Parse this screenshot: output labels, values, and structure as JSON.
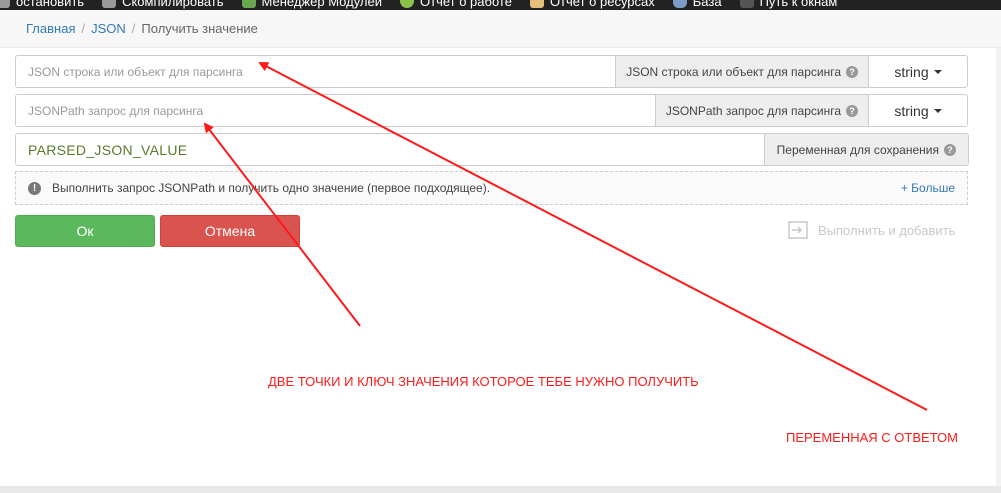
{
  "toolbar": {
    "items": [
      {
        "label": "остановить",
        "icon": "stop-icon"
      },
      {
        "label": "Скомпилировать",
        "icon": "compile-icon"
      },
      {
        "label": "Менеджер Модулей",
        "icon": "module-manager-icon"
      },
      {
        "label": "Отчет о работе",
        "icon": "chart-icon"
      },
      {
        "label": "Отчет о ресурсах",
        "icon": "folder-icon"
      },
      {
        "label": "База",
        "icon": "database-icon"
      },
      {
        "label": "Путь к окнам",
        "icon": "window-icon"
      }
    ]
  },
  "breadcrumb": {
    "home": "Главная",
    "section": "JSON",
    "current": "Получить значение",
    "separator": "/"
  },
  "form": {
    "json_string": {
      "value": "",
      "placeholder": "JSON строка или объект для парсинга",
      "label": "JSON строка или объект для парсинга",
      "type": "string"
    },
    "jsonpath": {
      "value": "",
      "placeholder": "JSONPath запрос для парсинга",
      "label": "JSONPath запрос для парсинга",
      "type": "string"
    },
    "save_var": {
      "value": "PARSED_JSON_VALUE",
      "label": "Переменная для сохранения"
    },
    "help_glyph": "?"
  },
  "info": {
    "icon_glyph": "!",
    "text": "Выполнить запрос JSONPath и получить одно значение (первое подходящее).",
    "more": "+ Больше"
  },
  "buttons": {
    "ok": "Ок",
    "cancel": "Отмена",
    "run_and_add": "Выполнить и добавить"
  },
  "annotations": {
    "jsonpath_note": "ДВЕ ТОЧКИ И КЛЮЧ ЗНАЧЕНИЯ КОТОРОЕ ТЕБЕ НУЖНО ПОЛУЧИТЬ",
    "result_note": "ПЕРЕМЕННАЯ С ОТВЕТОМ"
  },
  "colors": {
    "toolbar_bg": "#222222",
    "link": "#337ab7",
    "ok": "#5cb85c",
    "cancel": "#d9534f",
    "annotation": "#ff1a1a",
    "variable_text": "#5a7a2b"
  }
}
